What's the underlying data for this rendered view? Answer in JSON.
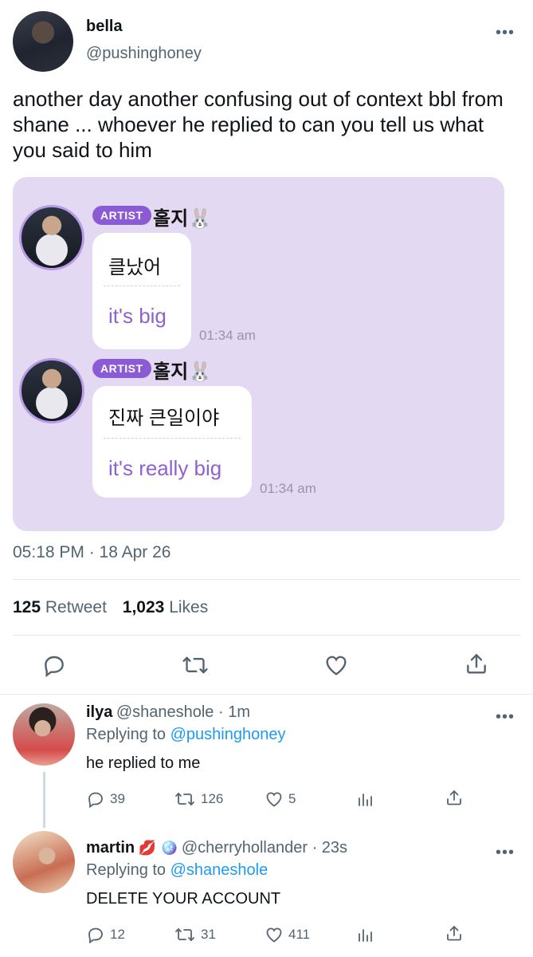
{
  "tweet": {
    "name": "bella",
    "handle": "@pushinghoney",
    "text": "another day another confusing out of context bbl from shane ... whoever he replied to can you tell us what you said to him",
    "datetime": "05:18 PM · 18 Apr 26",
    "retweet_count": "125",
    "retweet_label": "Retweet",
    "like_count": "1,023",
    "like_label": "Likes"
  },
  "media": {
    "messages": [
      {
        "badge": "ARTIST",
        "name": "홀지🐰",
        "korean": "클났어",
        "english": "it's big",
        "time": "01:34 am"
      },
      {
        "badge": "ARTIST",
        "name": "홀지🐰",
        "korean": "진짜 큰일이야",
        "english": "it's really big",
        "time": "01:34 am"
      }
    ]
  },
  "replies": [
    {
      "name": "ilya",
      "handle_time": "@shaneshole · 1m",
      "replying_prefix": "Replying to ",
      "replying_to": "@pushinghoney",
      "text": "he replied to me",
      "reply_count": "39",
      "retweet_count": "126",
      "like_count": "5"
    },
    {
      "name": "martin",
      "emoji": "💋 🪩",
      "handle_time": "@cherryhollander · 23s",
      "replying_prefix": "Replying to ",
      "replying_to": "@shaneshole",
      "text": "DELETE YOUR ACCOUNT",
      "reply_count": "12",
      "retweet_count": "31",
      "like_count": "411"
    }
  ],
  "more_glyph": "•••",
  "colors": {
    "link": "#1d9bf0",
    "muted": "#536471",
    "card_bg": "#e3d9f2",
    "artist_badge": "#8b5bd6",
    "translation": "#8e62cf"
  }
}
